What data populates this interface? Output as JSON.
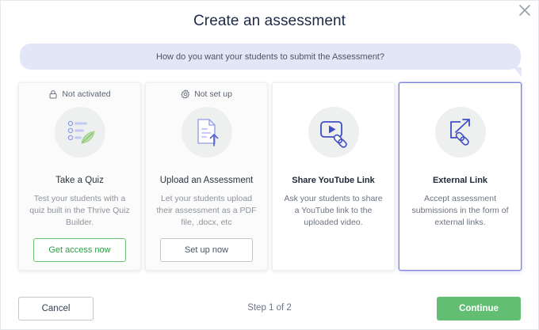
{
  "modal": {
    "title": "Create an assessment",
    "question": "How do you want your students to submit the Assessment?"
  },
  "cards": [
    {
      "status": "Not activated",
      "status_icon": "lock-icon",
      "icon": "quiz-list-icon",
      "title": "Take a Quiz",
      "description": "Test your students with a quiz built in the Thrive Quiz Builder.",
      "button_label": "Get access now"
    },
    {
      "status": "Not set up",
      "status_icon": "gear-icon",
      "icon": "upload-document-icon",
      "title": "Upload an Assessment",
      "description": "Let your students upload their assessment as a PDF file, .docx, etc",
      "button_label": "Set up now"
    },
    {
      "icon": "youtube-link-icon",
      "title": "Share YouTube Link",
      "description": "Ask your students to share a YouTube link to the uploaded video."
    },
    {
      "icon": "external-link-icon",
      "title": "External Link",
      "description": "Accept assessment submissions in the form of external links.",
      "selected": true
    }
  ],
  "footer": {
    "cancel_label": "Cancel",
    "step_text": "Step 1 of 2",
    "continue_label": "Continue"
  },
  "colors": {
    "accent_blue": "#3f4ec4",
    "green": "#62be72",
    "question_bg": "#e3e6f7"
  }
}
